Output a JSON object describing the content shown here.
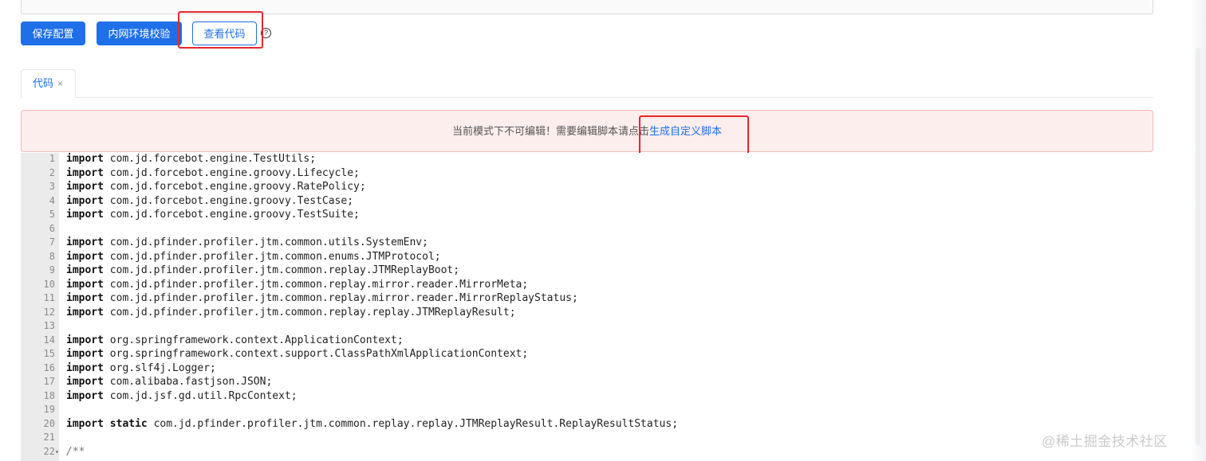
{
  "toolbar": {
    "save_label": "保存配置",
    "intranet_check_label": "内网环境校验",
    "view_code_label": "查看代码",
    "help_glyph": "?"
  },
  "tabs": [
    {
      "label": "代码",
      "close": "×"
    }
  ],
  "alert": {
    "text": "当前模式下不可编辑！需要编辑脚本请点击",
    "link": "生成自定义脚本"
  },
  "colors": {
    "primary": "#1e6fe8",
    "alert_bg": "#fdeeee",
    "highlight_box": "#e8262b"
  },
  "code": {
    "lines": [
      {
        "n": "1",
        "kw": "import",
        "rest": " com.jd.forcebot.engine.TestUtils;"
      },
      {
        "n": "2",
        "kw": "import",
        "rest": " com.jd.forcebot.engine.groovy.Lifecycle;"
      },
      {
        "n": "3",
        "kw": "import",
        "rest": " com.jd.forcebot.engine.groovy.RatePolicy;"
      },
      {
        "n": "4",
        "kw": "import",
        "rest": " com.jd.forcebot.engine.groovy.TestCase;"
      },
      {
        "n": "5",
        "kw": "import",
        "rest": " com.jd.forcebot.engine.groovy.TestSuite;"
      },
      {
        "n": "6",
        "kw": "",
        "rest": ""
      },
      {
        "n": "7",
        "kw": "import",
        "rest": " com.jd.pfinder.profiler.jtm.common.utils.SystemEnv;"
      },
      {
        "n": "8",
        "kw": "import",
        "rest": " com.jd.pfinder.profiler.jtm.common.enums.JTMProtocol;"
      },
      {
        "n": "9",
        "kw": "import",
        "rest": " com.jd.pfinder.profiler.jtm.common.replay.JTMReplayBoot;"
      },
      {
        "n": "10",
        "kw": "import",
        "rest": " com.jd.pfinder.profiler.jtm.common.replay.mirror.reader.MirrorMeta;"
      },
      {
        "n": "11",
        "kw": "import",
        "rest": " com.jd.pfinder.profiler.jtm.common.replay.mirror.reader.MirrorReplayStatus;"
      },
      {
        "n": "12",
        "kw": "import",
        "rest": " com.jd.pfinder.profiler.jtm.common.replay.replay.JTMReplayResult;"
      },
      {
        "n": "13",
        "kw": "",
        "rest": ""
      },
      {
        "n": "14",
        "kw": "import",
        "rest": " org.springframework.context.ApplicationContext;"
      },
      {
        "n": "15",
        "kw": "import",
        "rest": " org.springframework.context.support.ClassPathXmlApplicationContext;"
      },
      {
        "n": "16",
        "kw": "import",
        "rest": " org.slf4j.Logger;"
      },
      {
        "n": "17",
        "kw": "import",
        "rest": " com.alibaba.fastjson.JSON;"
      },
      {
        "n": "18",
        "kw": "import",
        "rest": " com.jd.jsf.gd.util.RpcContext;"
      },
      {
        "n": "19",
        "kw": "",
        "rest": ""
      },
      {
        "n": "20",
        "kw": "import static",
        "rest": " com.jd.pfinder.profiler.jtm.common.replay.replay.JTMReplayResult.ReplayResultStatus;"
      },
      {
        "n": "21",
        "kw": "",
        "rest": ""
      },
      {
        "n": "22",
        "kw": "",
        "rest": "",
        "comment": "/**",
        "fold": "▾"
      }
    ]
  },
  "watermark": "@稀土掘金技术社区"
}
